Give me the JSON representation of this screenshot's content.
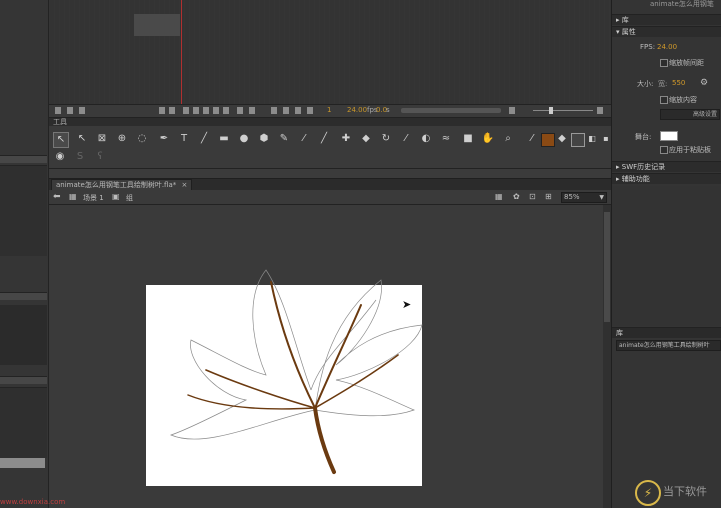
{
  "timeline": {
    "frame_field": "1",
    "fps_field": "24.00",
    "fps_unit": "fps",
    "time_field": "0.0",
    "time_unit": "s"
  },
  "tools_panel": {
    "title": "工具",
    "tools": [
      "selection-tool",
      "subselection-tool",
      "free-transform-tool",
      "3d-rotation-tool",
      "lasso-tool",
      "pen-tool",
      "text-tool",
      "line-tool",
      "rectangle-tool",
      "oval-tool",
      "polystar-tool",
      "pencil-tool",
      "brush-tool",
      "paint-brush-tool",
      "bone-tool",
      "paint-bucket-tool",
      "ink-bottle-tool",
      "eyedropper-tool",
      "eraser-tool",
      "width-tool",
      "camera-tool",
      "hand-tool",
      "zoom-tool"
    ],
    "stroke_color": "#8a4a14",
    "fill_color": "#444444"
  },
  "document": {
    "tab_label": "animate怎么用钢笔工具绘制树叶.fla*",
    "scene_label": "场景 1",
    "group_label": "组",
    "zoom_value": "85%",
    "stage_color": "#ffffff",
    "leaf_stroke_color": "#6b3a10"
  },
  "right_panel": {
    "top_label": "animate怎么用钢笔",
    "library_label": "库",
    "properties_label": "属性",
    "fps_label": "FPS:",
    "fps_value": "24.00",
    "scale_content_label": "缩放帧间距",
    "size_label": "大小:",
    "size_value": "550",
    "scale_label": "缩放内容",
    "advanced_settings_label": "高级设置",
    "stage_label": "舞台:",
    "apply_label": "应用于粘贴板",
    "swf_history_label": "SWF历史记录",
    "accessibility_label": "辅助功能",
    "lib_panel_label": "库",
    "lib_input": "animate怎么用钢笔工具绘制树叶"
  },
  "watermark": {
    "brand": "当下软件"
  },
  "site": {
    "text": "www.downxia.com"
  }
}
